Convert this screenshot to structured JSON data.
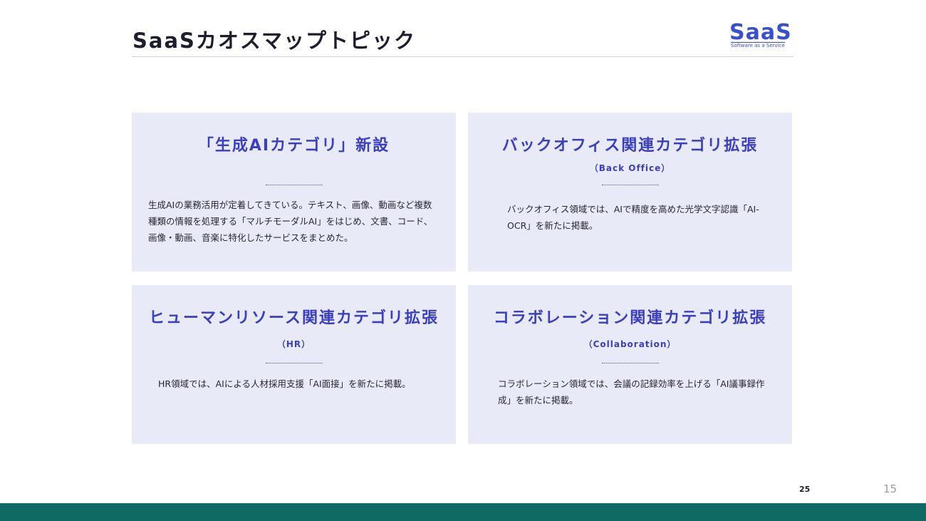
{
  "header": {
    "title": "SaaSカオスマップトピック"
  },
  "logo": {
    "wordmark": "SaaS",
    "tagline": "Software as a Service",
    "color": "#3a4fd0"
  },
  "cards": [
    {
      "title": "「生成AIカテゴリ」新設",
      "subtitle": "",
      "body": "生成AIの業務活用が定着してきている。テキスト、画像、動画など複数種類の情報を処理する「マルチモーダルAI」をはじめ、文書、コード、画像・動画、音楽に特化したサービスをまとめた。"
    },
    {
      "title": "バックオフィス関連カテゴリ拡張",
      "subtitle": "（Back Office）",
      "body": "バックオフィス領域では、AIで精度を高めた光学文字認識「AI-OCR」を新たに掲載。"
    },
    {
      "title": "ヒューマンリソース関連カテゴリ拡張",
      "subtitle": "（HR）",
      "body": "HR領域では、AIによる人材採用支援「AI面接」を新たに掲載。"
    },
    {
      "title": "コラボレーション関連カテゴリ拡張",
      "subtitle": "（Collaboration）",
      "body": "コラボレーション領域では、会議の記録効率を上げる「AI議事録作成」を新たに掲載。"
    }
  ],
  "footer": {
    "page_small": "25",
    "page_large": "15",
    "band_color": "#0f6a63"
  },
  "colors": {
    "card_background": "#e9eaf8",
    "accent": "#3b3fbf"
  }
}
